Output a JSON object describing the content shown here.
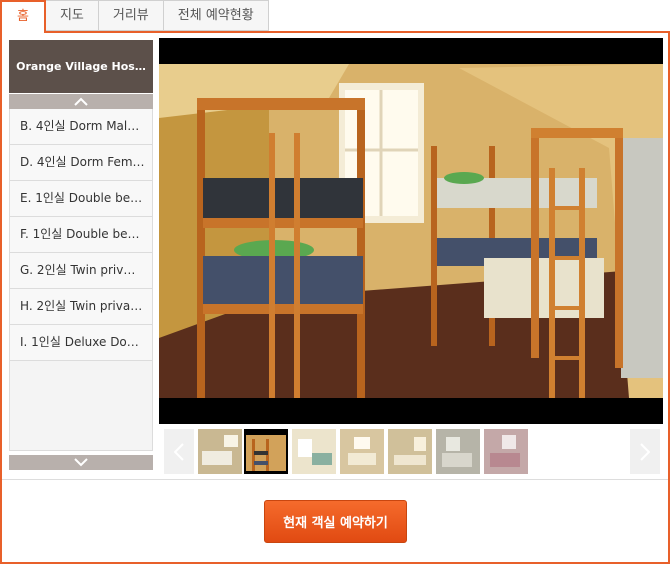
{
  "tabs": [
    {
      "label": "홈",
      "active": true
    },
    {
      "label": "지도",
      "active": false
    },
    {
      "label": "거리뷰",
      "active": false
    },
    {
      "label": "전체 예약현황",
      "active": false
    }
  ],
  "sidebar": {
    "hotel_name": "Orange Village Hos…",
    "rooms": [
      {
        "label": "B. 4인실 Dorm Mal…"
      },
      {
        "label": "D. 4인실 Dorm Fem…"
      },
      {
        "label": "E. 1인실 Double be…"
      },
      {
        "label": "F. 1인실 Double be…"
      },
      {
        "label": "G. 2인실 Twin priv…"
      },
      {
        "label": "H. 2인실 Twin priva…"
      },
      {
        "label": "I. 1인실 Deluxe Do…"
      }
    ],
    "scroll_up_icon": "chevron-up-icon",
    "scroll_down_icon": "chevron-down-icon"
  },
  "gallery": {
    "main_photo": "dorm-room-bunk-beds",
    "thumbnails": 7,
    "selected_thumbnail": 2
  },
  "actions": {
    "book_label": "현재 객실 예약하기"
  },
  "colors": {
    "accent": "#e8602a",
    "sidebar_header_bg": "#5c504a"
  }
}
